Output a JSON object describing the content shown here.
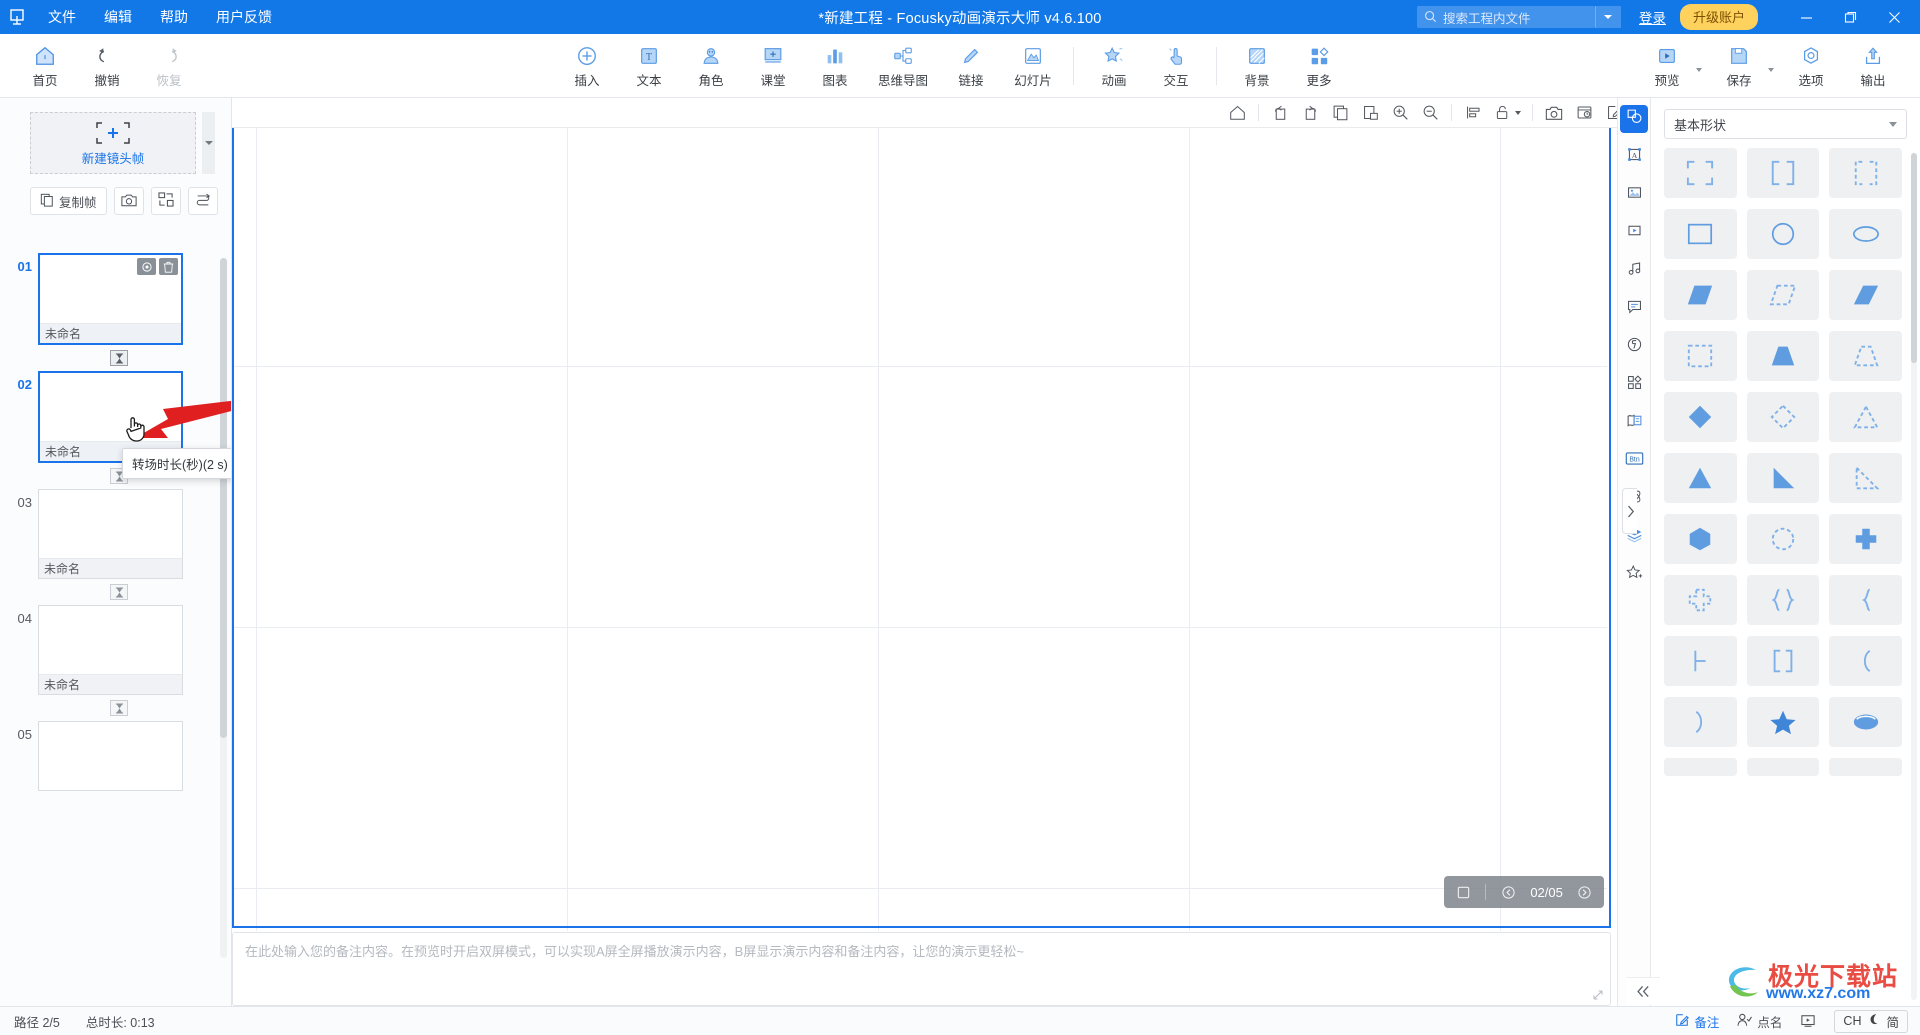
{
  "titlebar": {
    "logo_icon": "focusky-logo-icon",
    "menus": [
      {
        "label": "文件",
        "name": "menu-file"
      },
      {
        "label": "编辑",
        "name": "menu-edit"
      },
      {
        "label": "帮助",
        "name": "menu-help"
      },
      {
        "label": "用户反馈",
        "name": "menu-feedback"
      }
    ],
    "title": "*新建工程 - Focusky动画演示大师  v4.6.100",
    "search_placeholder": "搜索工程内文件",
    "search_value": "",
    "login_label": "登录",
    "upgrade_label": "升级账户",
    "window_buttons": [
      "minimize",
      "maximize",
      "close"
    ],
    "accent": "#1278e8",
    "upgrade_bg": "#ffd25e"
  },
  "ribbon": {
    "left": [
      {
        "label": "首页",
        "icon": "home-icon",
        "disabled": false
      },
      {
        "label": "撤销",
        "icon": "undo-icon",
        "disabled": false
      },
      {
        "label": "恢复",
        "icon": "redo-icon",
        "disabled": true
      }
    ],
    "center": [
      {
        "label": "插入",
        "icon": "plus-circle-icon"
      },
      {
        "label": "文本",
        "icon": "text-box-icon"
      },
      {
        "label": "角色",
        "icon": "character-icon"
      },
      {
        "label": "课堂",
        "icon": "classroom-icon"
      },
      {
        "label": "图表",
        "icon": "bar-chart-icon"
      },
      {
        "label": "思维导图",
        "icon": "mindmap-icon"
      },
      {
        "label": "链接",
        "icon": "link-icon"
      },
      {
        "label": "幻灯片",
        "icon": "slide-icon"
      },
      {
        "label": "动画",
        "icon": "star-animation-icon"
      },
      {
        "label": "交互",
        "icon": "hand-click-icon"
      },
      {
        "label": "背景",
        "icon": "background-icon"
      },
      {
        "label": "更多",
        "icon": "more-grid-icon"
      }
    ],
    "right": [
      {
        "label": "预览",
        "icon": "preview-play-icon",
        "caret": true
      },
      {
        "label": "保存",
        "icon": "save-disk-icon",
        "caret": true
      },
      {
        "label": "选项",
        "icon": "options-gear-icon",
        "caret": false
      },
      {
        "label": "输出",
        "icon": "export-upload-icon",
        "caret": false
      }
    ]
  },
  "left_panel": {
    "new_frame_label": "新建镜头帧",
    "new_frame_icon": "crop-plus-icon",
    "tools": [
      {
        "label": "复制帧",
        "icon": "copy-frame-icon",
        "name": "duplicate-frame-button"
      },
      {
        "label": "",
        "icon": "camera-icon",
        "name": "capture-frame-button"
      },
      {
        "label": "",
        "icon": "fit-frame-icon",
        "name": "fit-frame-button"
      },
      {
        "label": "",
        "icon": "reorder-path-icon",
        "name": "reorder-path-button"
      }
    ],
    "frames": [
      {
        "num": "01",
        "title": "未命名",
        "active": true,
        "has_actions": true
      },
      {
        "num": "02",
        "title": "未命名",
        "active": true,
        "has_actions": false
      },
      {
        "num": "03",
        "title": "未命名",
        "active": false,
        "has_actions": false
      },
      {
        "num": "04",
        "title": "未命名",
        "active": false,
        "has_actions": false
      },
      {
        "num": "05",
        "title": "",
        "active": false,
        "has_actions": false
      }
    ],
    "transition_icon": "hourglass-icon",
    "tooltip": "转场时长(秒)(2 s)"
  },
  "canvas": {
    "toolbar": [
      {
        "icon": "home-outline-icon",
        "name": "canvas-home-button"
      },
      {
        "icon": "rotate-left-icon",
        "name": "rotate-left-button"
      },
      {
        "icon": "rotate-right-icon",
        "name": "rotate-right-button"
      },
      {
        "icon": "copy-icon",
        "name": "copy-button"
      },
      {
        "icon": "paste-icon",
        "name": "paste-button"
      },
      {
        "icon": "zoom-in-icon",
        "name": "zoom-in-button"
      },
      {
        "icon": "zoom-out-icon",
        "name": "zoom-out-button"
      },
      {
        "icon": "align-icon",
        "name": "align-button"
      },
      {
        "icon": "unlock-icon",
        "name": "lock-button",
        "caret": true
      },
      {
        "icon": "camera-icon",
        "name": "screenshot-button"
      },
      {
        "icon": "timer-camera-icon",
        "name": "record-button"
      },
      {
        "icon": "edit-pen-icon",
        "name": "edit-button"
      }
    ],
    "page_indicator": "02/05",
    "pager_icons": [
      "pager-stop-icon",
      "pager-prev-icon",
      "pager-next-icon"
    ],
    "notes_placeholder": "在此处输入您的备注内容。在预览时开启双屏模式，可以实现A屏全屏播放演示内容，B屏显示演示内容和备注内容，让您的演示更轻松~",
    "notes_value": ""
  },
  "right_panel": {
    "rail": [
      {
        "icon": "shapes-icon",
        "name": "rail-shapes",
        "active": true
      },
      {
        "icon": "text-frame-icon",
        "name": "rail-text",
        "active": false
      },
      {
        "icon": "image-icon",
        "name": "rail-image",
        "active": false
      },
      {
        "icon": "video-icon",
        "name": "rail-video",
        "active": false
      },
      {
        "icon": "music-icon",
        "name": "rail-music",
        "active": false
      },
      {
        "icon": "speech-bubble-icon",
        "name": "rail-bubble",
        "active": false
      },
      {
        "icon": "flash-icon",
        "name": "rail-flash",
        "active": false
      },
      {
        "icon": "more-grid-icon",
        "name": "rail-more",
        "active": false
      },
      {
        "icon": "form-icon",
        "name": "rail-form",
        "active": false
      },
      {
        "icon": "button-icon",
        "name": "rail-button",
        "active": false
      },
      {
        "icon": "atom-icon",
        "name": "rail-atom",
        "active": false
      },
      {
        "icon": "layers-icon",
        "name": "rail-layers",
        "active": false
      },
      {
        "icon": "star-add-icon",
        "name": "rail-favorite",
        "active": false
      }
    ],
    "category_label": "基本形状",
    "shapes": [
      "corner-brackets",
      "square-brackets",
      "dashed-brackets",
      "rectangle",
      "circle",
      "ellipse",
      "parallelogram-filled",
      "parallelogram-dashed",
      "parallelogram-solid",
      "dashed-square",
      "trapezoid-filled",
      "trapezoid-dashed",
      "diamond-filled",
      "diamond-dashed",
      "triangle-dashed",
      "triangle-filled",
      "right-triangle",
      "right-angle-dashed",
      "hexagon-filled",
      "circle-dashed",
      "cross-filled",
      "cross-dashed",
      "curly-braces",
      "left-brace",
      "bracket-tee",
      "square-brackets-2",
      "left-paren",
      "right-paren",
      "star-filled",
      "oval-button"
    ]
  },
  "statusbar": {
    "path_label": "路径 2/5",
    "total_label": "总时长: 0:13",
    "note_label": "备注",
    "rollcall_label": "点名",
    "ime_lang": "CH",
    "ime_mode": "简",
    "collapse_icon": "double-chevron-left-icon"
  },
  "watermark": {
    "line1": "极光下载站",
    "line2": "www.xz7.com"
  }
}
